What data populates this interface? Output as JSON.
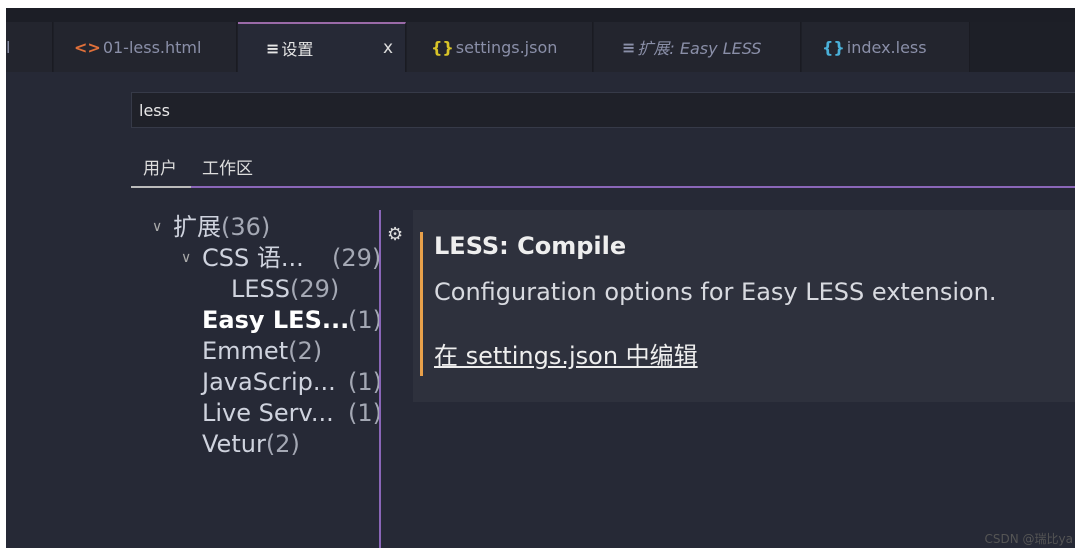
{
  "tabs": [
    {
      "label": "l",
      "icon": ""
    },
    {
      "label": "01-less.html",
      "icon": "<>",
      "color": "#e0703a"
    },
    {
      "label": "设置",
      "icon": "≡",
      "active": true
    },
    {
      "label": "settings.json",
      "icon": "{}",
      "color": "#d8c428"
    },
    {
      "label": "扩展: Easy LESS",
      "icon": "≡"
    },
    {
      "label": "index.less",
      "icon": "{}",
      "color": "#4ab0d8"
    }
  ],
  "close_label": "x",
  "search": {
    "value": "less"
  },
  "scopes": [
    "用户",
    "工作区"
  ],
  "tree": [
    {
      "label": "扩展",
      "count": "(36)"
    },
    {
      "label": "CSS 语...",
      "count": "(29)"
    },
    {
      "label": "LESS",
      "count": "(29)"
    },
    {
      "label": "Easy LES...",
      "count": "(1)"
    },
    {
      "label": "Emmet",
      "count": "(2)"
    },
    {
      "label": "JavaScrip...",
      "count": "(1)"
    },
    {
      "label": "Live Serv...",
      "count": "(1)"
    },
    {
      "label": "Vetur",
      "count": "(2)"
    }
  ],
  "setting": {
    "title": "LESS: Compile",
    "description": "Configuration options for Easy LESS extension.",
    "link": "在 settings.json 中编辑"
  },
  "watermark": "CSDN @瑞比ya",
  "colors": {
    "accent": "#8a66b8",
    "modified": "#e8a04a"
  }
}
